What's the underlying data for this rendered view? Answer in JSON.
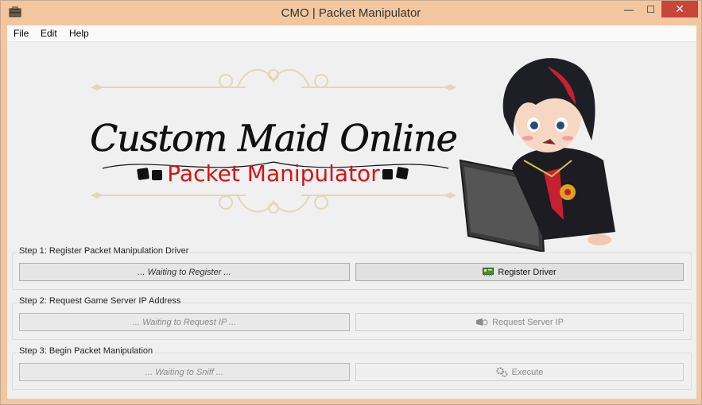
{
  "window": {
    "title": "CMO | Packet Manipulator",
    "controls": {
      "minimize": "—",
      "maximize": "☐",
      "close": "✕"
    }
  },
  "menu": [
    "File",
    "Edit",
    "Help"
  ],
  "banner": {
    "title": "Custom Maid Online",
    "subtitle": "Packet Manipulator",
    "subtitle_color": "#d41515"
  },
  "steps": [
    {
      "label": "Step 1: Register Packet Manipulation Driver",
      "status": "... Waiting to Register ...",
      "button": "Register Driver",
      "button_icon": "network-card-icon",
      "enabled": true
    },
    {
      "label": "Step 2: Request Game Server IP Address",
      "status": "... Waiting to Request IP ...",
      "button": "Request Server IP",
      "button_icon": "remote-request-icon",
      "enabled": false
    },
    {
      "label": "Step 3: Begin Packet Manipulation",
      "status": "... Waiting to Sniff ...",
      "button": "Execute",
      "button_icon": "gears-icon",
      "enabled": false
    }
  ],
  "colors": {
    "titlebar": "#f2c79f",
    "close": "#c7453a",
    "accent_red": "#d41515"
  }
}
